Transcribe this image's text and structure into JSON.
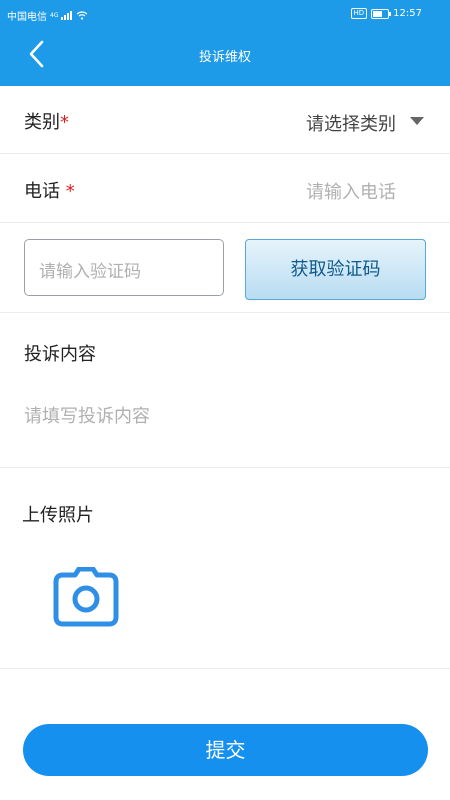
{
  "status_bar": {
    "carrier": "中国电信",
    "network": "4G",
    "hd": "HD",
    "time": "12:57"
  },
  "header": {
    "title": "投诉维权",
    "background_color": "#1e9be8"
  },
  "form": {
    "category": {
      "label": "类别",
      "required_mark": "*",
      "value": "请选择类别"
    },
    "phone": {
      "label": "电话",
      "required_mark": "*",
      "placeholder": "请输入电话"
    },
    "verification": {
      "placeholder": "请输入验证码",
      "button_label": "获取验证码"
    },
    "complaint": {
      "label": "投诉内容",
      "placeholder": "请填写投诉内容"
    },
    "photos": {
      "label": "上传照片",
      "icon": "camera-icon"
    }
  },
  "submit": {
    "label": "提交",
    "color": "#1690ee"
  }
}
